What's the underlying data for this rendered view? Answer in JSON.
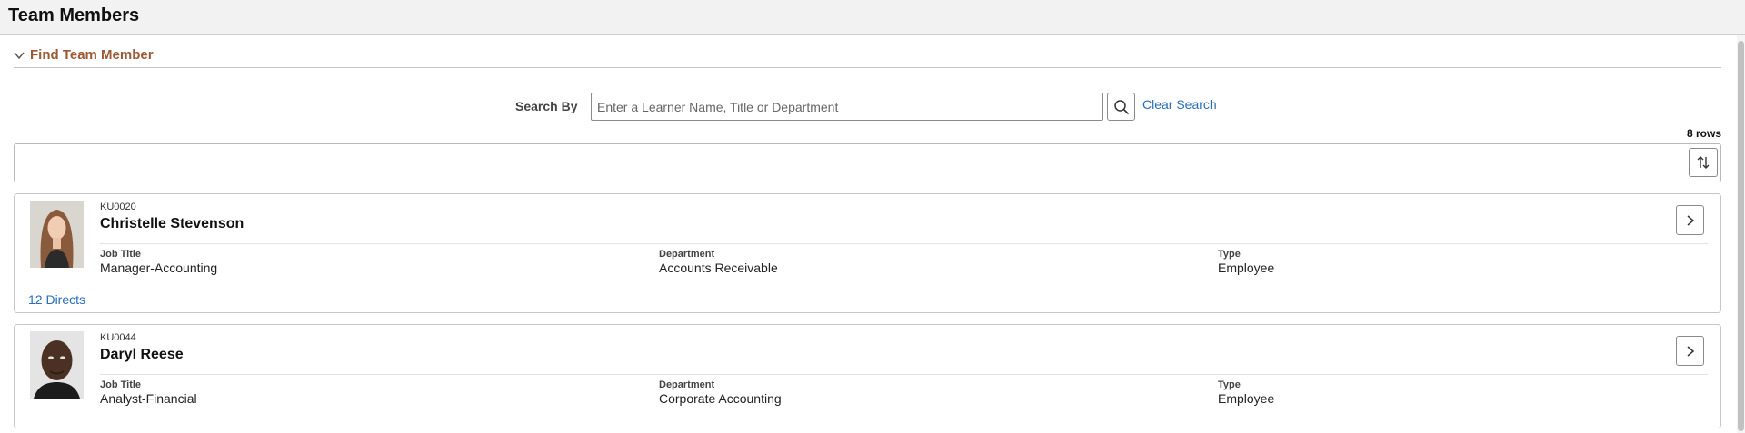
{
  "header": {
    "title": "Team Members"
  },
  "find_section": {
    "title": "Find Team Member"
  },
  "search": {
    "label": "Search By",
    "placeholder": "Enter a Learner Name, Title or Department",
    "value": "",
    "clear_label": "Clear Search"
  },
  "results": {
    "rows_label": "8 rows"
  },
  "field_labels": {
    "job_title": "Job Title",
    "department": "Department",
    "type": "Type"
  },
  "cards": [
    {
      "id": "KU0020",
      "name": "Christelle Stevenson",
      "job_title": "Manager-Accounting",
      "department": "Accounts Receivable",
      "type": "Employee",
      "directs": "12 Directs"
    },
    {
      "id": "KU0044",
      "name": "Daryl Reese",
      "job_title": "Analyst-Financial",
      "department": "Corporate Accounting",
      "type": "Employee"
    }
  ],
  "colors": {
    "section_title": "#9c5a35",
    "link": "#2a6ebb",
    "header_bg": "#f2f2f2"
  },
  "icons": {
    "chevron": "chevron-down-icon",
    "search": "search-icon",
    "sort": "sort-icon",
    "next": "chevron-right-icon"
  }
}
